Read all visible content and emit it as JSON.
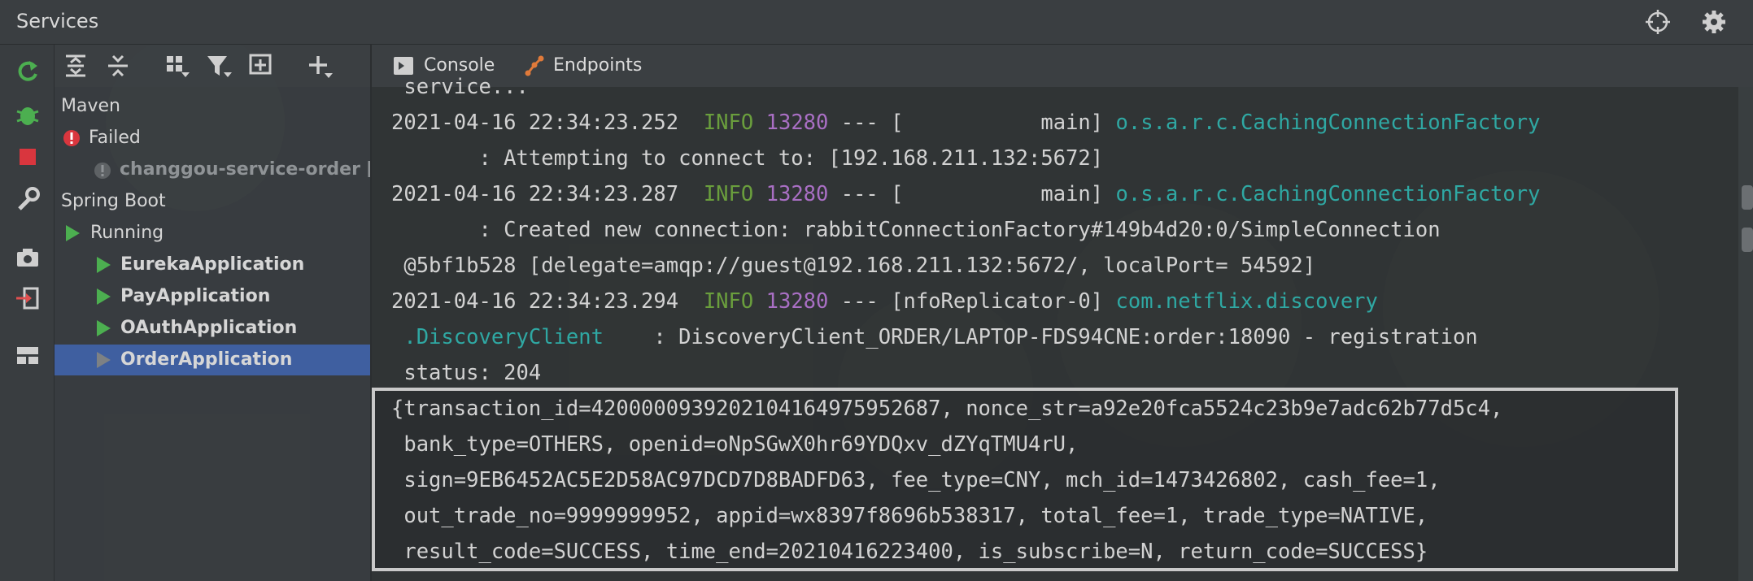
{
  "window": {
    "title": "Services"
  },
  "titlebar_icons": [
    "crosshair-icon",
    "gear-icon"
  ],
  "left_toolbar_icons": [
    "rerun-icon",
    "debug-icon",
    "stop-icon",
    "wrench-icon",
    "camera-icon",
    "login-icon",
    "layout-icon"
  ],
  "tree_toolbar_icons": [
    "expand-all-icon",
    "collapse-all-icon",
    "group-icon",
    "filter-icon",
    "new-service-icon",
    "add-icon"
  ],
  "tabs": [
    {
      "label": "Console",
      "icon": "console-icon"
    },
    {
      "label": "Endpoints",
      "icon": "endpoints-icon"
    }
  ],
  "tree": {
    "maven": "Maven",
    "failed": "Failed",
    "failed_item": "changgou-service-order [co",
    "spring_boot": "Spring Boot",
    "running": "Running",
    "apps": [
      "EurekaApplication",
      "PayApplication",
      "OAuthApplication",
      "OrderApplication"
    ],
    "selected": "OrderApplication"
  },
  "console": {
    "lines": [
      {
        "text": " service..."
      },
      {
        "ts": "2021-04-16 22:34:23.252",
        "level": "INFO",
        "pid": "13280",
        "mid": " --- [           main] ",
        "logger": "o.s.a.r.c.CachingConnectionFactory"
      },
      {
        "text": "       : Attempting to connect to: [192.168.211.132:5672]"
      },
      {
        "ts": "2021-04-16 22:34:23.287",
        "level": "INFO",
        "pid": "13280",
        "mid": " --- [           main] ",
        "logger": "o.s.a.r.c.CachingConnectionFactory"
      },
      {
        "text": "       : Created new connection: rabbitConnectionFactory#149b4d20:0/SimpleConnection"
      },
      {
        "text": " @5bf1b528 [delegate=amqp://guest@192.168.211.132:5672/, localPort= 54592]"
      },
      {
        "ts": "2021-04-16 22:34:23.294",
        "level": "INFO",
        "pid": "13280",
        "mid": " --- [nfoReplicator-0] ",
        "logger": "com.netflix.discovery"
      },
      {
        "logger_cont": " .DiscoveryClient",
        "text": "    : DiscoveryClient_ORDER/LAPTOP-FDS94CNE:order:18090 - registration"
      },
      {
        "text": " status: 204"
      },
      {
        "text": "{transaction_id=4200000939202104164975952687, nonce_str=a92e20fca5524c23b9e7adc62b77d5c4,"
      },
      {
        "text": " bank_type=OTHERS, openid=oNpSGwX0hr69YDQxv_dZYqTMU4rU,"
      },
      {
        "text": " sign=9EB6452AC5E2D58AC97DCD7D8BADFD63, fee_type=CNY, mch_id=1473426802, cash_fee=1,"
      },
      {
        "text": " out_trade_no=9999999952, appid=wx8397f8696b538317, total_fee=1, trade_type=NATIVE,"
      },
      {
        "text": " result_code=SUCCESS, time_end=20210416223400, is_subscribe=N, return_code=SUCCESS}"
      }
    ]
  },
  "colors": {
    "info_level": "#6a9e3d",
    "pid": "#a96fc4",
    "logger": "#2fa8a3",
    "selection": "#3f5fa0",
    "running_green": "#4caf50",
    "failed_red": "#d9363e"
  }
}
